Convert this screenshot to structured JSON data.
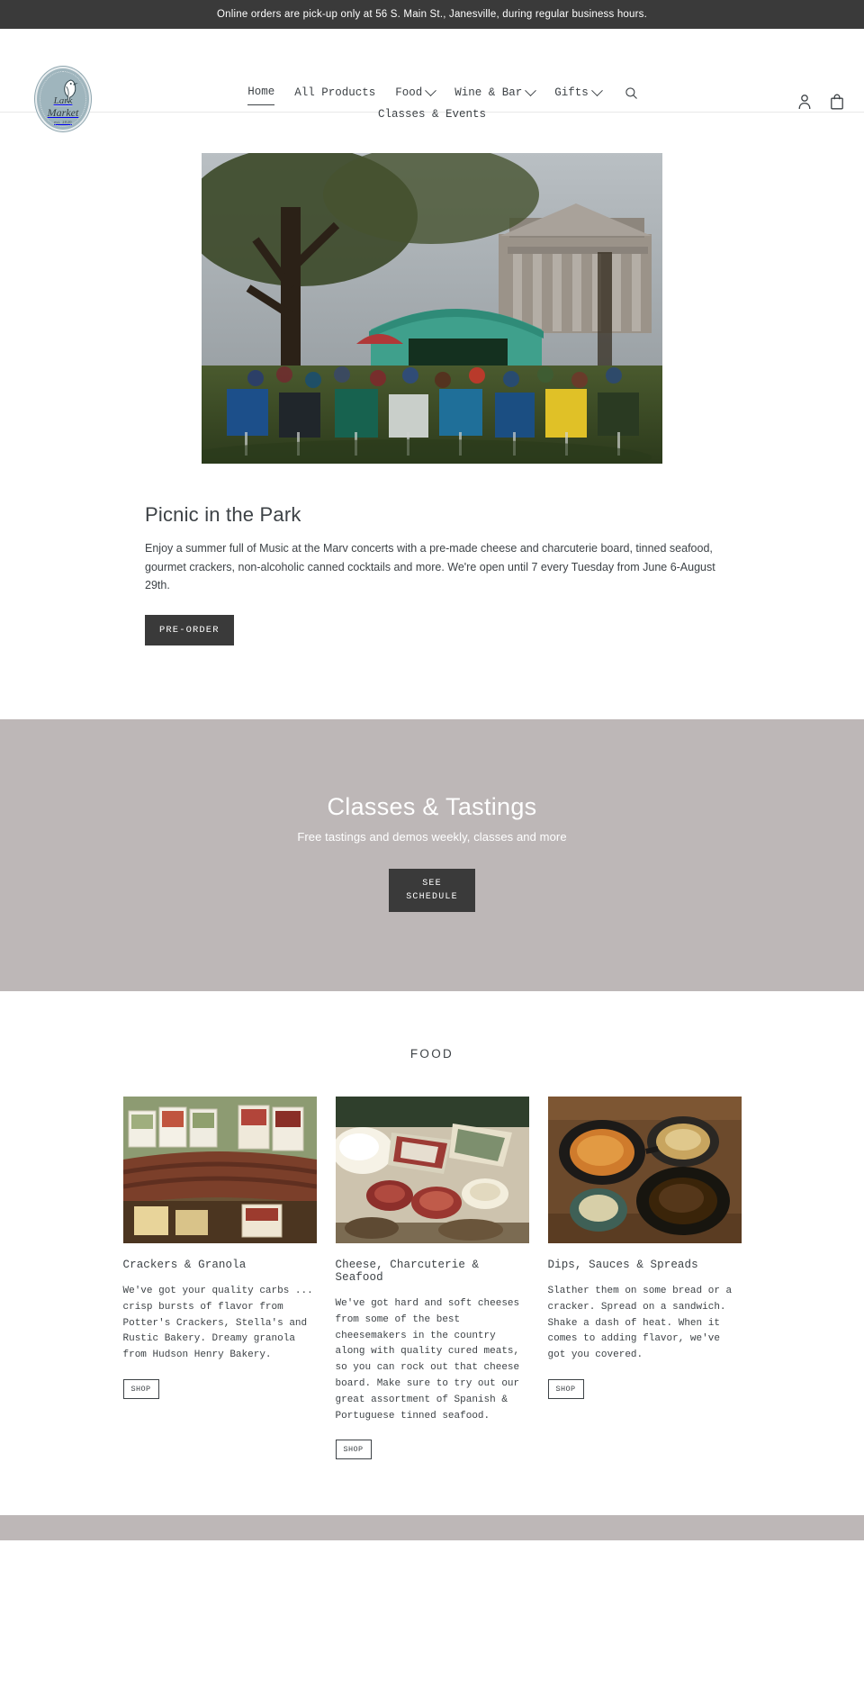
{
  "announcement": {
    "text": "Online orders are pick-up only at 56 S. Main St., Janesville, during regular business hours."
  },
  "logo": {
    "line1": "Lark",
    "line2": "Market",
    "line3": "est. 2020",
    "icon": "lark-bird-icon"
  },
  "nav": {
    "items": [
      {
        "label": "Home",
        "has_dropdown": false,
        "active": true
      },
      {
        "label": "All Products",
        "has_dropdown": false,
        "active": false
      },
      {
        "label": "Food",
        "has_dropdown": true,
        "active": false
      },
      {
        "label": "Wine & Bar",
        "has_dropdown": true,
        "active": false
      },
      {
        "label": "Gifts",
        "has_dropdown": true,
        "active": false
      }
    ],
    "second_row": [
      {
        "label": "Classes & Events",
        "has_dropdown": false,
        "active": false
      }
    ],
    "search_icon": "search-icon",
    "account_icon": "account-person-icon",
    "cart_icon": "shopping-bag-icon"
  },
  "feature": {
    "image_alt": "Outdoor concert crowd in lawn chairs under a green tent at a park with a courthouse building",
    "title": "Picnic in the Park",
    "text": "Enjoy a summer full of Music at the Marv concerts with a pre-made cheese and charcuterie board, tinned seafood, gourmet crackers, non-alcoholic canned cocktails and more. We're open until 7 every Tuesday from June 6-August 29th.",
    "button_label": "PRE-ORDER"
  },
  "banner": {
    "title": "Classes & Tastings",
    "subtitle": "Free tastings and demos weekly, classes and more",
    "button_line1": "SEE",
    "button_line2": "SCHEDULE",
    "background_color": "#bdb7b7"
  },
  "food_section": {
    "title": "FOOD",
    "cards": [
      {
        "title": "Crackers & Granola",
        "text": "We've got your quality carbs ... crisp bursts of flavor from Potter's Crackers, Stella's and Rustic Bakery. Dreamy granola from Hudson Henry Bakery.",
        "button_label": "SHOP",
        "image_alt": "Display basket of assorted cracker boxes and Potter's Crackers packages"
      },
      {
        "title": "Cheese, Charcuterie & Seafood",
        "text": "We've got hard and soft cheeses from some of the best cheesemakers in the country along with quality cured meats, so you can rock out that cheese board. Make sure to try out our great assortment of Spanish & Portuguese tinned seafood.",
        "button_label": "SHOP",
        "image_alt": "Charcuterie board with blue cheese, brie, salami and cured meats"
      },
      {
        "title": "Dips, Sauces & Spreads",
        "text": "Slather them on some bread or a cracker. Spread on a sandwich. Shake a dash of heat. When it comes to adding flavor, we've got you covered.",
        "button_label": "SHOP",
        "image_alt": "Cast iron skillets with orange sauce and dark spread on a wooden table"
      }
    ]
  },
  "colors": {
    "announce_bg": "#3a3a3a",
    "text": "#3d4246",
    "banner_bg": "#bdb7b7",
    "button_dark": "#3a3a3a",
    "logo_bg": "#9fb5bd"
  }
}
